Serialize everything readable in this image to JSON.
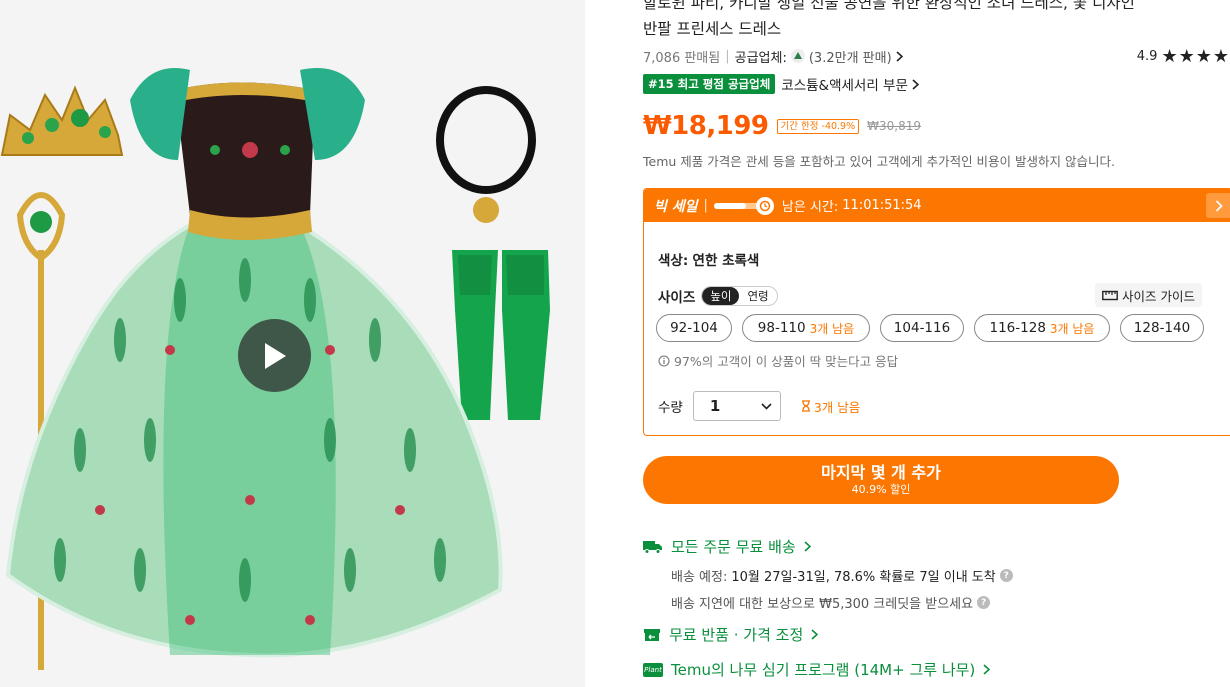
{
  "product": {
    "title_lines": [
      "할로윈 파티, 카니발 생일 선물 공연을 위한 환상적인 소녀 드레스, 꽃 디자인",
      "반팔 프린세스 드레스"
    ],
    "sold_count": "7,086 판매됨",
    "supplier_label": "공급업체:",
    "supplier_sales": "(3.2만개 판매)",
    "rating": "4.9",
    "rank_badge": "#15 최고 평점 공급업체",
    "category_link": "코스튬&액세서리 부문",
    "price": "₩18,199",
    "limited_tag": "기간 한정 -40.9%",
    "original_price": "₩30,819",
    "tax_note": "Temu 제품 가격은 관세 등을 포함하고 있어 고객에게 추가적인 비용이 발생하지 않습니다."
  },
  "sale": {
    "title": "빅 세일",
    "timer_prefix": "남은 시간:",
    "timer_value": "11:01:51:54",
    "timer_fraction": 0.62,
    "color_label": "색상:",
    "color_value": "연한 초록색",
    "size_label": "사이즈",
    "size_modes": [
      "높이",
      "연령"
    ],
    "size_guide": "사이즈 가이드",
    "sizes": [
      {
        "label": "92-104",
        "stock": ""
      },
      {
        "label": "98-110",
        "stock": "3개 남음"
      },
      {
        "label": "104-116",
        "stock": ""
      },
      {
        "label": "116-128",
        "stock": "3개 남음"
      },
      {
        "label": "128-140",
        "stock": ""
      }
    ],
    "fit_note": "97%의 고객이 이 상품이 딱 맞는다고 응답",
    "qty_label": "수량",
    "qty_value": "1",
    "stock_left": "3개 남음"
  },
  "cta": {
    "main": "마지막 몇 개 추가",
    "sub": "40.9% 할인"
  },
  "shipping": {
    "free_shipping": "모든 주문 무료 배송",
    "eta_prefix": "배송 예정:",
    "eta_value": "10월 27일-31일, 78.6% 확률로 7일 이내 도착",
    "delay_credit": "배송 지연에 대한 보상으로 ₩5,300 크레딧을 받으세요",
    "free_returns": "무료 반품 · 가격 조정",
    "tree_program": "Temu의 나무 심기 프로그램 (14M+ 그루 나무)",
    "plant_tag": "Plant"
  },
  "colors": {
    "accent": "#fb7701",
    "price": "#fb5a00",
    "green": "#0a8f3c"
  },
  "icons": [
    "play-icon",
    "supplier-avatar-icon",
    "chevron-right-icon",
    "star-icon",
    "timer-icon",
    "ruler-icon",
    "info-icon",
    "dropdown-chevron-icon",
    "hourglass-icon",
    "truck-icon",
    "return-box-icon",
    "plant-icon",
    "question-icon"
  ]
}
